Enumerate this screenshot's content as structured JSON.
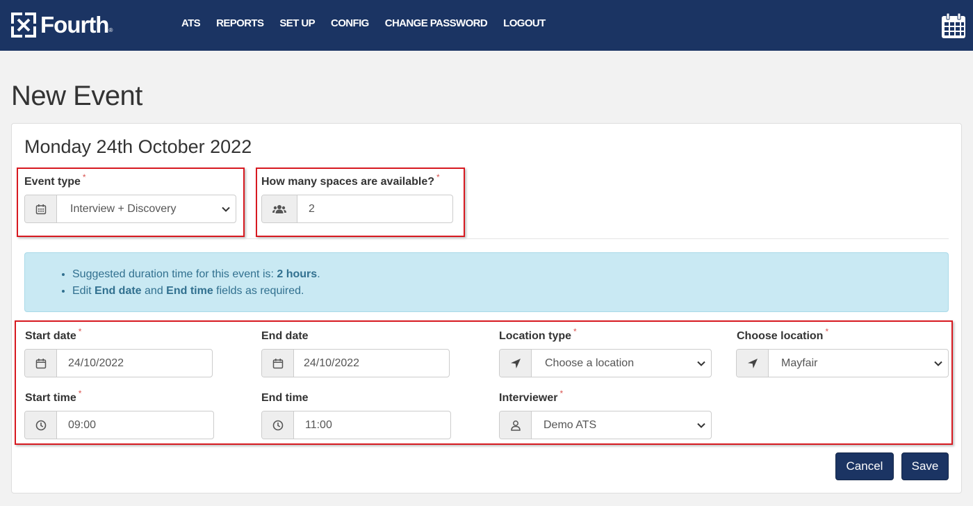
{
  "brand": {
    "name": "Fourth",
    "reg": "®"
  },
  "nav": [
    {
      "label": "ATS"
    },
    {
      "label": "REPORTS"
    },
    {
      "label": "SET UP"
    },
    {
      "label": "CONFIG"
    },
    {
      "label": "CHANGE PASSWORD"
    },
    {
      "label": "LOGOUT"
    }
  ],
  "page": {
    "title": "New Event",
    "date_heading": "Monday 24th October 2022"
  },
  "form": {
    "required_marker": "*",
    "event_type": {
      "label": "Event type",
      "value": "Interview + Discovery",
      "icon": "calendar-icon"
    },
    "spaces": {
      "label": "How many spaces are available?",
      "value": "2",
      "icon": "users-icon"
    },
    "start_date": {
      "label": "Start date",
      "value": "24/10/2022",
      "icon": "calendar-icon"
    },
    "end_date": {
      "label": "End date",
      "value": "24/10/2022",
      "icon": "calendar-icon"
    },
    "location_type": {
      "label": "Location type",
      "value": "Choose a location",
      "icon": "location-arrow-icon"
    },
    "choose_location": {
      "label": "Choose location",
      "value": "Mayfair",
      "icon": "location-arrow-icon"
    },
    "start_time": {
      "label": "Start time",
      "value": "09:00",
      "icon": "clock-icon"
    },
    "end_time": {
      "label": "End time",
      "value": "11:00",
      "icon": "clock-icon"
    },
    "interviewer": {
      "label": "Interviewer",
      "value": "Demo ATS",
      "icon": "user-icon"
    }
  },
  "alert": {
    "line1_prefix": "Suggested duration time for this event is: ",
    "line1_bold": "2 hours",
    "line1_suffix": ".",
    "line2_a": "Edit ",
    "line2_b": "End date",
    "line2_c": " and ",
    "line2_d": "End time",
    "line2_e": " fields as required."
  },
  "buttons": {
    "cancel": "Cancel",
    "save": "Save"
  },
  "colors": {
    "navbar": "#1b3463",
    "highlight": "#d71920",
    "alert_bg": "#c9e9f3",
    "alert_text": "#31708f"
  }
}
